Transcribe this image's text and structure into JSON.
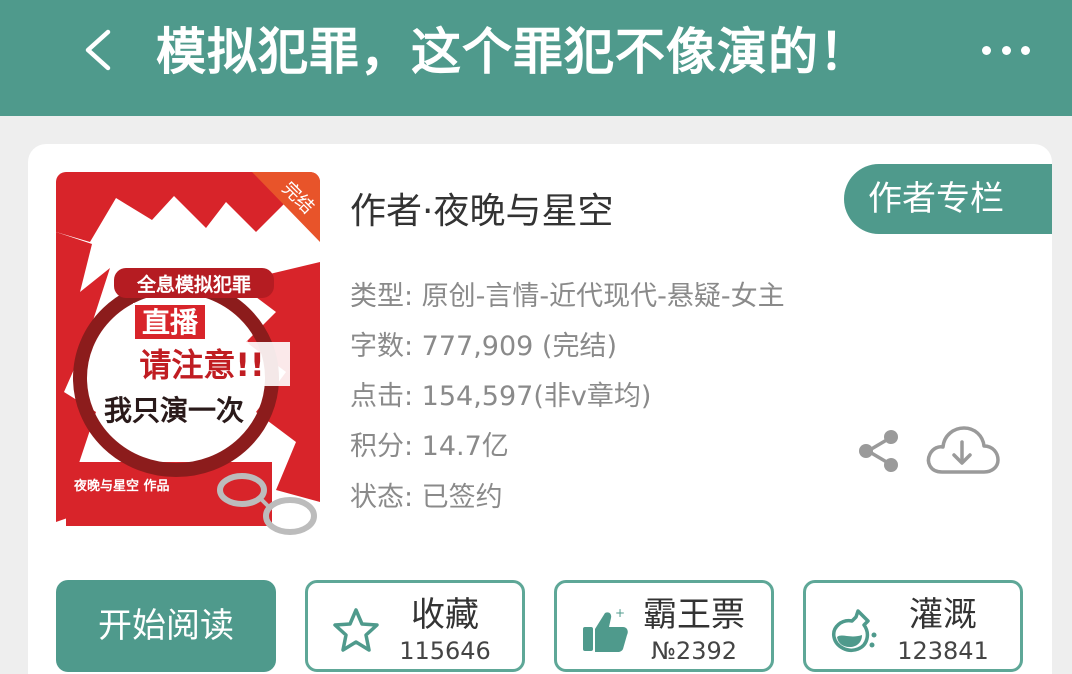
{
  "header": {
    "title": "模拟犯罪，这个罪犯不像演的！"
  },
  "book": {
    "author": "作者·夜晚与星空",
    "author_column_label": "作者专栏",
    "meta": [
      {
        "label": "类型",
        "text": "类型: 原创-言情-近代现代-悬疑-女主"
      },
      {
        "label": "字数",
        "text": "字数: 777,909 (完结)"
      },
      {
        "label": "点击",
        "text": "点击: 154,597(非v章均)"
      },
      {
        "label": "积分",
        "text": "积分: 14.7亿"
      },
      {
        "label": "状态",
        "text": "状态: 已签约"
      }
    ]
  },
  "cover": {
    "badge": "完结",
    "banner": "全息模拟犯罪",
    "line1": "直播",
    "line2": "请注意!!",
    "line3": "我只演一次",
    "signature": "夜晚与星空 作品"
  },
  "actions": {
    "start_reading": "开始阅读",
    "favorite": {
      "label": "收藏",
      "value": "115646",
      "icon": "star-icon"
    },
    "ticket": {
      "label": "霸王票",
      "value": "№2392",
      "icon": "thumbs-up-icon"
    },
    "nutrient": {
      "label": "灌溉",
      "value": "123841",
      "icon": "flask-icon"
    }
  },
  "colors": {
    "accent": "#4f9a8c",
    "cover_red": "#d8242a"
  }
}
